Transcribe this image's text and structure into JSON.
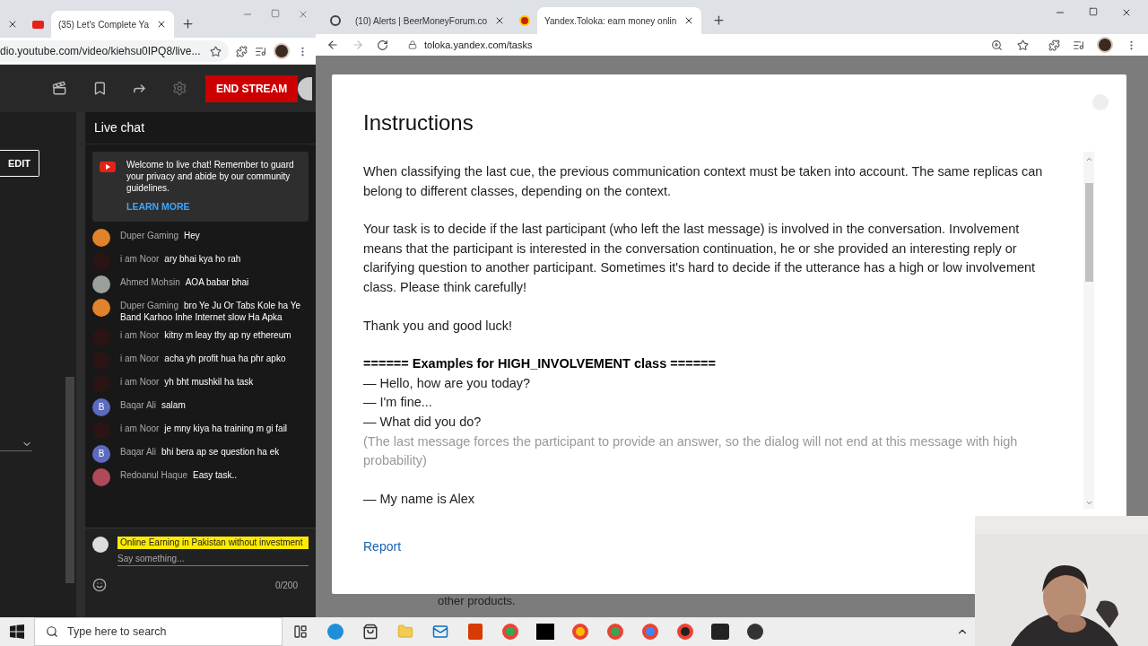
{
  "left_window": {
    "tabs": [
      {
        "title": "(35) Let's Complete Ya",
        "selected": true
      }
    ],
    "url": "dio.youtube.com/video/kiehsu0IPQ8/live...",
    "header": {
      "end_stream": "END STREAM"
    },
    "edit_button": "EDIT",
    "chat": {
      "title": "Live chat",
      "welcome": "Welcome to live chat! Remember to guard your privacy and abide by our community guidelines.",
      "learn_more": "LEARN MORE",
      "messages": [
        {
          "author": "Duper Gaming",
          "text": "Hey",
          "avatar": {
            "color": "#e0832a"
          }
        },
        {
          "author": "i am Noor",
          "text": "ary bhai kya ho rah",
          "avatar": {
            "color": "#2a1414"
          }
        },
        {
          "author": "Ahmed Mohsin",
          "text": "AOA babar bhai",
          "avatar": {
            "color": "#9aa09a"
          }
        },
        {
          "author": "Duper Gaming",
          "text": "bro Ye Ju Or Tabs Kole ha Ye Band Karhoo Inhe Internet slow Ha Apka",
          "avatar": {
            "color": "#e0832a"
          }
        },
        {
          "author": "i am Noor",
          "text": "kitny m leay thy ap ny ethereum",
          "avatar": {
            "color": "#2a1414"
          }
        },
        {
          "author": "i am Noor",
          "text": "acha yh profit hua ha phr apko",
          "avatar": {
            "color": "#2a1414"
          }
        },
        {
          "author": "i am Noor",
          "text": "yh bht mushkil ha task",
          "avatar": {
            "color": "#2a1414"
          }
        },
        {
          "author": "Baqar Ali",
          "text": "salam",
          "avatar": {
            "color": "#5c6bc0",
            "letter": "B"
          }
        },
        {
          "author": "i am Noor",
          "text": "je mny kiya ha training m gi fail",
          "avatar": {
            "color": "#2a1414"
          }
        },
        {
          "author": "Baqar Ali",
          "text": "bhi bera ap se question ha ek",
          "avatar": {
            "color": "#5c6bc0",
            "letter": "B"
          }
        },
        {
          "author": "Redoanul Haque",
          "text": "Easy task..",
          "avatar": {
            "color": "#b04a5a"
          }
        }
      ],
      "pinned": "Online Earning in Pakistan without investment",
      "placeholder": "Say something...",
      "counter": "0/200"
    }
  },
  "right_window": {
    "tabs": [
      {
        "title": "(10) Alerts | BeerMoneyForum.co",
        "selected": false
      },
      {
        "title": "Yandex.Toloka: earn money onlin",
        "selected": true
      }
    ],
    "url": "toloka.yandex.com/tasks",
    "page_footer": "other products.",
    "modal": {
      "title": "Instructions",
      "sections": [
        [
          {
            "kind": "text",
            "text": "When classifying the last cue, the previous communication context must be taken into account. The same replicas can belong to different classes, depending on the context."
          }
        ],
        [
          {
            "kind": "text",
            "text": "Your task is to decide if the last participant (who left the last message) is involved in the conversation. Involvement means that the participant is interested in the conversation continuation, he or she provided an interesting reply or clarifying question to another participant. Sometimes it's hard to decide if the utterance has a high or low involvement class. Please think carefully!"
          }
        ],
        [
          {
            "kind": "text",
            "text": "Thank you and good luck!"
          }
        ],
        [
          {
            "kind": "heading",
            "text": "======  Examples for HIGH_INVOLVEMENT class  ======"
          },
          {
            "kind": "text",
            "text": "— Hello, how are you today?"
          },
          {
            "kind": "text",
            "text": "— I'm fine..."
          },
          {
            "kind": "text",
            "text": "— What did you do?"
          },
          {
            "kind": "note",
            "text": "(The last message forces the participant to provide an answer, so the dialog will not end at this message with high probability)"
          }
        ],
        [
          {
            "kind": "text",
            "text": "— My name is Alex"
          }
        ]
      ],
      "report": "Report"
    }
  },
  "taskbar": {
    "search_placeholder": "Type here to search"
  }
}
